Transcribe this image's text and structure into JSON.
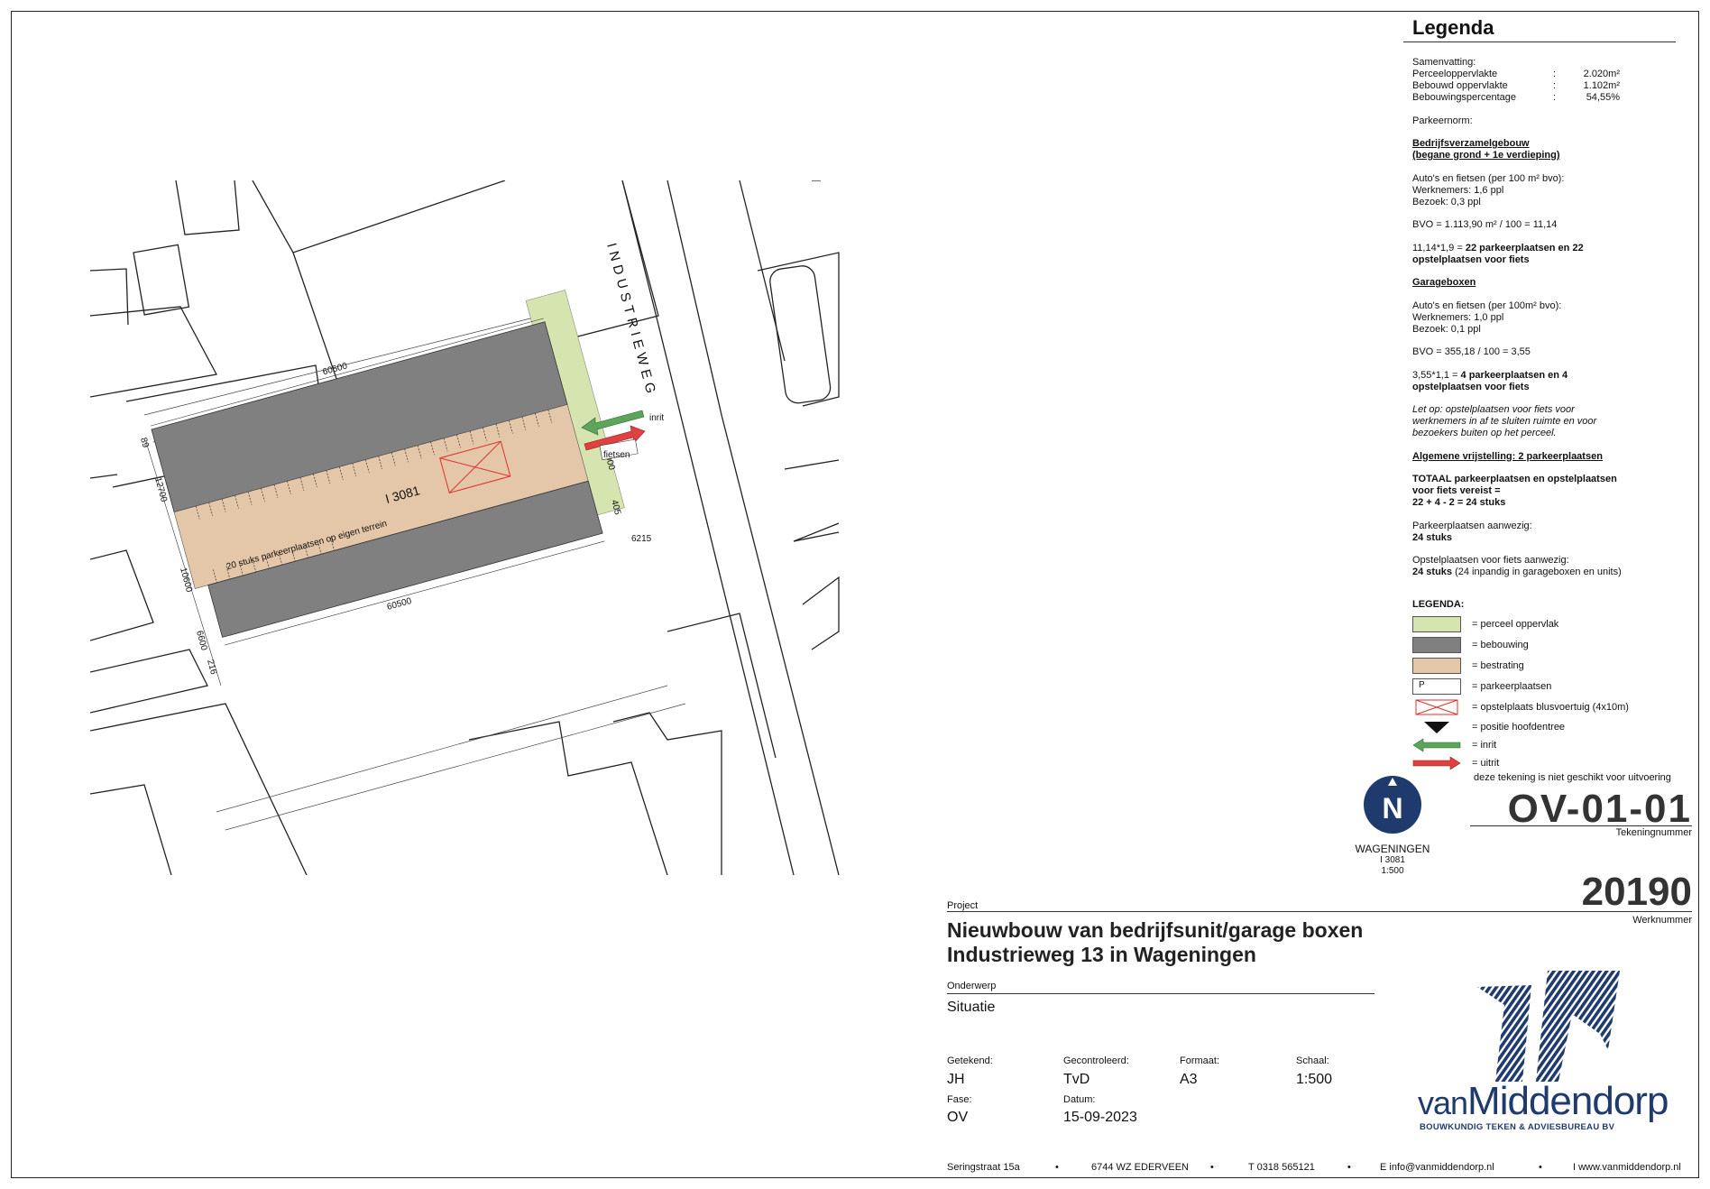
{
  "colors": {
    "perceel": "#d6e4b0",
    "bebouwing": "#808080",
    "bestrating": "#e4c6a8",
    "inrit": "#5da55d",
    "uitrit": "#e04040",
    "brand": "#1f3b6e"
  },
  "plan": {
    "street_name": "INDUSTRIEWEG",
    "lot_label": "I 3081",
    "parking_label": "20 stuks parkeerplaatsen op eigen terrein",
    "inrit_label": "inrit",
    "fietsen_label": "fietsen",
    "dims": [
      "60500",
      "60500",
      "12700",
      "10600",
      "6600",
      "216",
      "89",
      "6215",
      "5000",
      "405"
    ]
  },
  "legend": {
    "title": "Legenda",
    "summary_label": "Samenvatting:",
    "summary": [
      {
        "key": "Perceeloppervlakte",
        "sep": ":",
        "value": "2.020m²"
      },
      {
        "key": "Bebouwd oppervlakte",
        "sep": ":",
        "value": "1.102m²"
      },
      {
        "key": "Bebouwingspercentage",
        "sep": ":",
        "value": "54,55%"
      }
    ],
    "parkeernorm": "Parkeernorm:",
    "s1_title_1": "Bedrijfsverzamelgebouw",
    "s1_title_2": "(begane grond + 1e verdieping)",
    "s1_l1": "Auto's en fietsen (per 100 m² bvo):",
    "s1_l2": "Werknemers: 1,6 ppl",
    "s1_l3": "Bezoek: 0,3 ppl",
    "s1_bvo": "BVO = 1.113,90 m² / 100 = 11,14",
    "s1_calc_a": "11,14*1,9 = ",
    "s1_calc_b": "22 parkeerplaatsen en 22",
    "s1_calc_c": "opstelplaatsen voor fiets",
    "s2_title": "Garageboxen",
    "s2_l1": "Auto's en fietsen (per 100m² bvo):",
    "s2_l2": "Werknemers: 1,0 ppl",
    "s2_l3": "Bezoek: 0,1 ppl",
    "s2_bvo": "BVO = 355,18 / 100 = 3,55",
    "s2_calc_a": "3,55*1,1 = ",
    "s2_calc_b": "4 parkeerplaatsen en 4",
    "s2_calc_c": "opstelplaatsen voor fiets",
    "note_1": "Let op: opstelplaatsen voor fiets voor",
    "note_2": "werknemers in af te sluiten ruimte en voor",
    "note_3": "bezoekers buiten op het perceel.",
    "vrijstelling": "Algemene vrijstelling: 2 parkeerplaatsen",
    "totaal_a": "TOTAAL",
    "totaal_b": " parkeerplaatsen en opstelplaatsen",
    "totaal_c": "voor fiets vereist =",
    "totaal_d": "22 + 4 - 2 = 24 stuks",
    "aanwezig_l": "Parkeerplaatsen aanwezig:",
    "aanwezig_v": "24 stuks",
    "fiets_l": "Opstelplaatsen voor fiets aanwezig:",
    "fiets_v": "24 stuks",
    "fiets_note": " (24 inpandig in garageboxen en units)",
    "legend_head": "LEGENDA:",
    "items": [
      {
        "label": "= perceel oppervlak"
      },
      {
        "label": "= bebouwing"
      },
      {
        "label": "= bestrating"
      },
      {
        "label": "= parkeerplaatsen",
        "sym": "P"
      },
      {
        "label": "= opstelplaats blusvoertuig (4x10m)"
      },
      {
        "label": "= positie hoofdentree"
      },
      {
        "label": "= inrit"
      },
      {
        "label": "= uitrit"
      }
    ],
    "disclaimer": "deze tekening is niet geschikt voor uitvoering"
  },
  "north": {
    "letter": "N",
    "town": "WAGENINGEN",
    "lot": "I 3081",
    "scale": "1:500"
  },
  "title_block": {
    "drawing_number": "OV-01-01",
    "drawing_number_label": "Tekeningnummer",
    "werknummer": "20190",
    "werknummer_label": "Werknummer",
    "project_label": "Project",
    "project_line1": "Nieuwbouw van bedrijfsunit/garage boxen",
    "project_line2": "Industrieweg 13 in Wageningen",
    "onderwerp_label": "Onderwerp",
    "onderwerp": "Situatie",
    "getekend_label": "Getekend:",
    "getekend": "JH",
    "gecontroleerd_label": "Gecontroleerd:",
    "gecontroleerd": "TvD",
    "formaat_label": "Formaat:",
    "formaat": "A3",
    "schaal_label": "Schaal:",
    "schaal": "1:500",
    "fase_label": "Fase:",
    "fase": "OV",
    "datum_label": "Datum:",
    "datum": "15-09-2023"
  },
  "company": {
    "name_small": "van",
    "name_big": "Middendorp",
    "tagline": "BOUWKUNDIG TEKEN & ADVIESBUREAU BV",
    "address": "Seringstraat 15a",
    "postcode": "6744 WZ EDERVEEN",
    "phone": "T 0318 565121",
    "email": "E info@vanmiddendorp.nl",
    "web": "I www.vanmiddendorp.nl",
    "sep": "•"
  }
}
